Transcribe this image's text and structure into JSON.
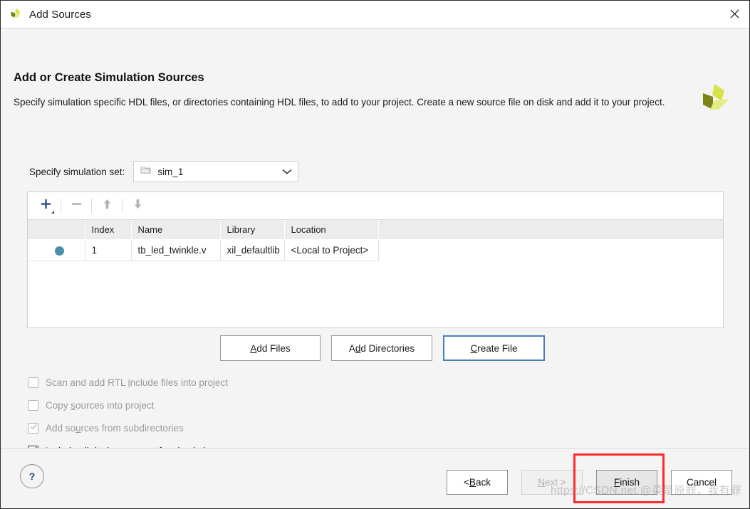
{
  "window": {
    "title": "Add Sources",
    "logo_icon": "xilinx-logo-icon",
    "close_icon": "close-icon"
  },
  "header": {
    "heading": "Add or Create Simulation Sources",
    "description": "Specify simulation specific HDL files, or directories containing HDL files, to add to your project. Create a new source file on disk and add it to your project.",
    "brand_logo_icon": "xilinx-logo-icon"
  },
  "simulation_set": {
    "label": "Specify simulation set:",
    "value": "sim_1",
    "folder_icon": "folder-icon",
    "chevron_icon": "chevron-down-icon"
  },
  "table_toolbar": {
    "add_label": "+",
    "add_icon": "plus-icon",
    "remove_icon": "minus-icon",
    "move_up_icon": "arrow-up-icon",
    "move_down_icon": "arrow-down-icon"
  },
  "sources_table": {
    "columns": [
      "",
      "Index",
      "Name",
      "Library",
      "Location",
      ""
    ],
    "rows": [
      {
        "status_dot": "●",
        "index": "1",
        "name": "tb_led_twinkle.v",
        "library": "xil_defaultlib",
        "location": "<Local to Project>"
      }
    ]
  },
  "add_buttons": [
    {
      "pre": "",
      "accel": "A",
      "post": "dd Files",
      "name": "add-files-button",
      "focused": false
    },
    {
      "pre": "A",
      "accel": "d",
      "post": "d Directories",
      "name": "add-directories-button",
      "focused": false
    },
    {
      "pre": "",
      "accel": "C",
      "post": "reate File",
      "name": "create-file-button",
      "focused": true
    }
  ],
  "options": [
    {
      "pre": "Scan and add RTL ",
      "accel": "i",
      "post": "nclude files into project",
      "checked": false,
      "enabled": false
    },
    {
      "pre": "Copy ",
      "accel": "s",
      "post": "ources into project",
      "checked": false,
      "enabled": false
    },
    {
      "pre": "Add so",
      "accel": "u",
      "post": "rces from subdirectories",
      "checked": true,
      "enabled": false
    },
    {
      "pre": "Include all design so",
      "accel": "u",
      "post": "rces for simulation",
      "checked": true,
      "enabled": true
    }
  ],
  "footer": {
    "help_label": "?",
    "buttons": [
      {
        "pre": "< ",
        "accel": "B",
        "post": "ack",
        "name": "back-button",
        "state": "normal"
      },
      {
        "pre": "",
        "accel": "N",
        "post": "ext >",
        "name": "next-button",
        "state": "disabled"
      },
      {
        "pre": "",
        "accel": "F",
        "post": "inish",
        "name": "finish-button",
        "state": "highlighted"
      },
      {
        "pre": "Cancel",
        "accel": "",
        "post": "",
        "name": "cancel-button",
        "state": "normal"
      }
    ]
  },
  "annotation": {
    "highlight_color": "#fd2b2b",
    "watermark": "https://CSDN.net @菜是原罪，我有罪"
  },
  "colors": {
    "status_dot": "#4a90a8",
    "focus_border": "#4a7ebb",
    "accent_logo_light": "#d8e34a",
    "accent_logo_dark": "#7d8416",
    "accent_logo_pale": "#e5ec86"
  }
}
